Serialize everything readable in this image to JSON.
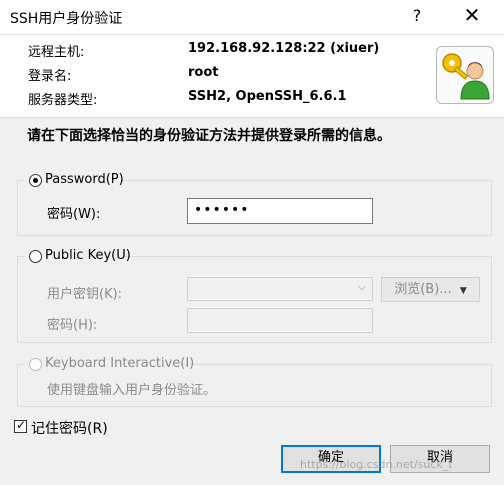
{
  "window": {
    "title": "SSH用户身份验证",
    "help_symbol": "?",
    "close_symbol": "✕"
  },
  "info": {
    "host_label": "远程主机:",
    "host_value": "192.168.92.128:22 (xiuer)",
    "login_label": "登录名:",
    "login_value": "root",
    "server_type_label": "服务器类型:",
    "server_type_value": "SSH2, OpenSSH_6.6.1"
  },
  "instruction": "请在下面选择恰当的身份验证方法并提供登录所需的信息。",
  "password_method": {
    "label": "Password(P)",
    "password_label": "密码(W):",
    "password_value": "••••••",
    "selected": true
  },
  "publickey_method": {
    "label": "Public Key(U)",
    "user_key_label": "用户密钥(K):",
    "browse_label": "浏览(B)...",
    "passphrase_label": "密码(H):",
    "selected": false
  },
  "keyboard_method": {
    "label": "Keyboard Interactive(I)",
    "description": "使用键盘输入用户身份验证。",
    "selected": false
  },
  "remember": {
    "label": "记住密码(R)",
    "checked": true
  },
  "buttons": {
    "ok": "确定",
    "cancel": "取消"
  },
  "watermark": "https://blog.csdn.net/suck_t",
  "icons": {
    "app": "key-user-icon",
    "dropdown": "chevron-down-icon"
  }
}
